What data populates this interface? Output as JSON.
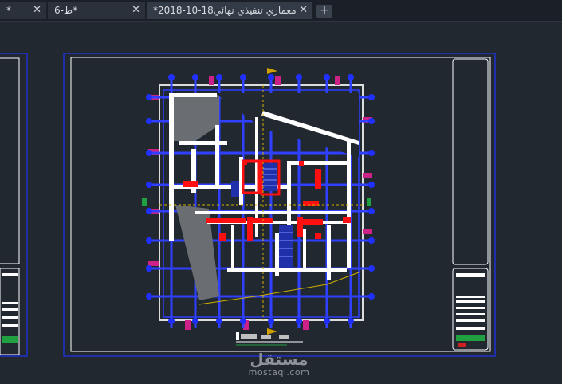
{
  "tabs": [
    {
      "label": "*",
      "active": false
    },
    {
      "label": "ط-6*",
      "active": false
    },
    {
      "label": "*معماري تنفيذي نهائي18-10-2018",
      "active": true
    }
  ],
  "close_glyph": "✕",
  "new_tab_glyph": "+",
  "watermark": {
    "brand": "مستقل",
    "domain": "mostaql.com"
  },
  "drawing": {
    "background": "#212830",
    "frame_color": "#2030d0",
    "border_color": "#ffffff",
    "column_color": "#ff0000",
    "axis_color": "#3040ff",
    "hatch_color": "#8a8a8a",
    "accent_color": "#cc2288"
  }
}
